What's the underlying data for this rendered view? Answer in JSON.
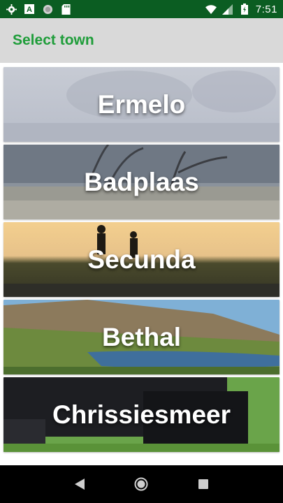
{
  "status_bar": {
    "time": "7:51",
    "icons_left": [
      "settings-icon",
      "font-icon",
      "globe-icon",
      "sd-card-icon"
    ],
    "icons_right": [
      "wifi-icon",
      "signal-icon",
      "battery-icon"
    ]
  },
  "app_bar": {
    "title": "Select town",
    "title_color": "#1f9d3a",
    "background": "#d9d9d9"
  },
  "towns": [
    {
      "name": "Ermelo"
    },
    {
      "name": "Badplaas"
    },
    {
      "name": "Secunda"
    },
    {
      "name": "Bethal"
    },
    {
      "name": "Chrissiesmeer"
    }
  ],
  "nav_bar": {
    "buttons": [
      "back-icon",
      "home-icon",
      "recents-icon"
    ]
  }
}
